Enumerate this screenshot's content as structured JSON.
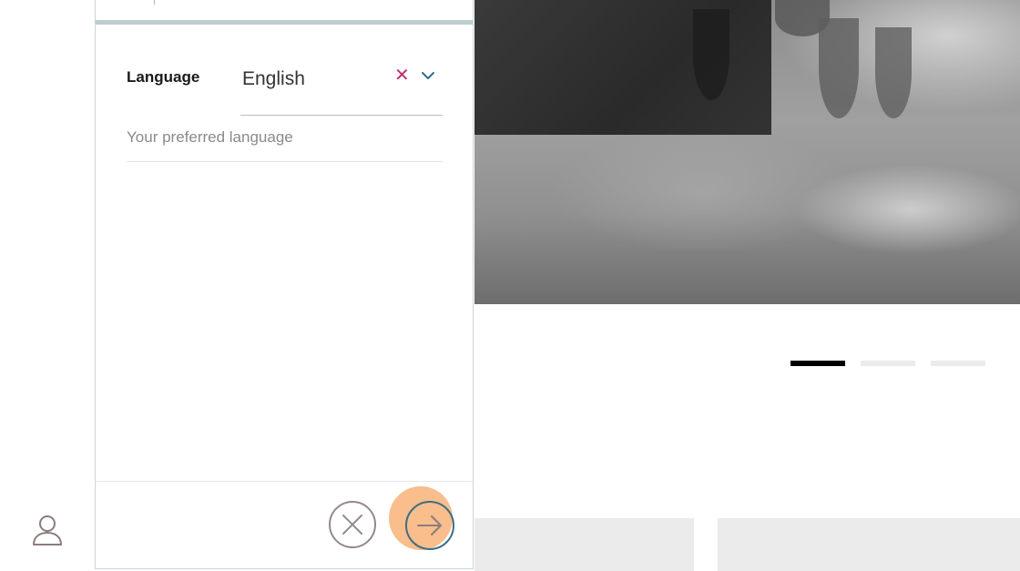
{
  "form": {
    "field_label": "Language",
    "field_value": "English",
    "helper_text": "Your preferred language",
    "clear_icon": "close-icon",
    "dropdown_icon": "chevron-down-icon"
  },
  "footer": {
    "cancel_icon": "close-circle-icon",
    "next_icon": "arrow-right-circle-icon"
  },
  "carousel": {
    "indicator_count": 3,
    "active_index": 0
  },
  "colors": {
    "clear_icon": "#c0306a",
    "chevron": "#2e6f8e",
    "next_button_highlight": "#f9b278",
    "active_indicator": "#000000",
    "inactive_indicator": "#ebebeb"
  }
}
